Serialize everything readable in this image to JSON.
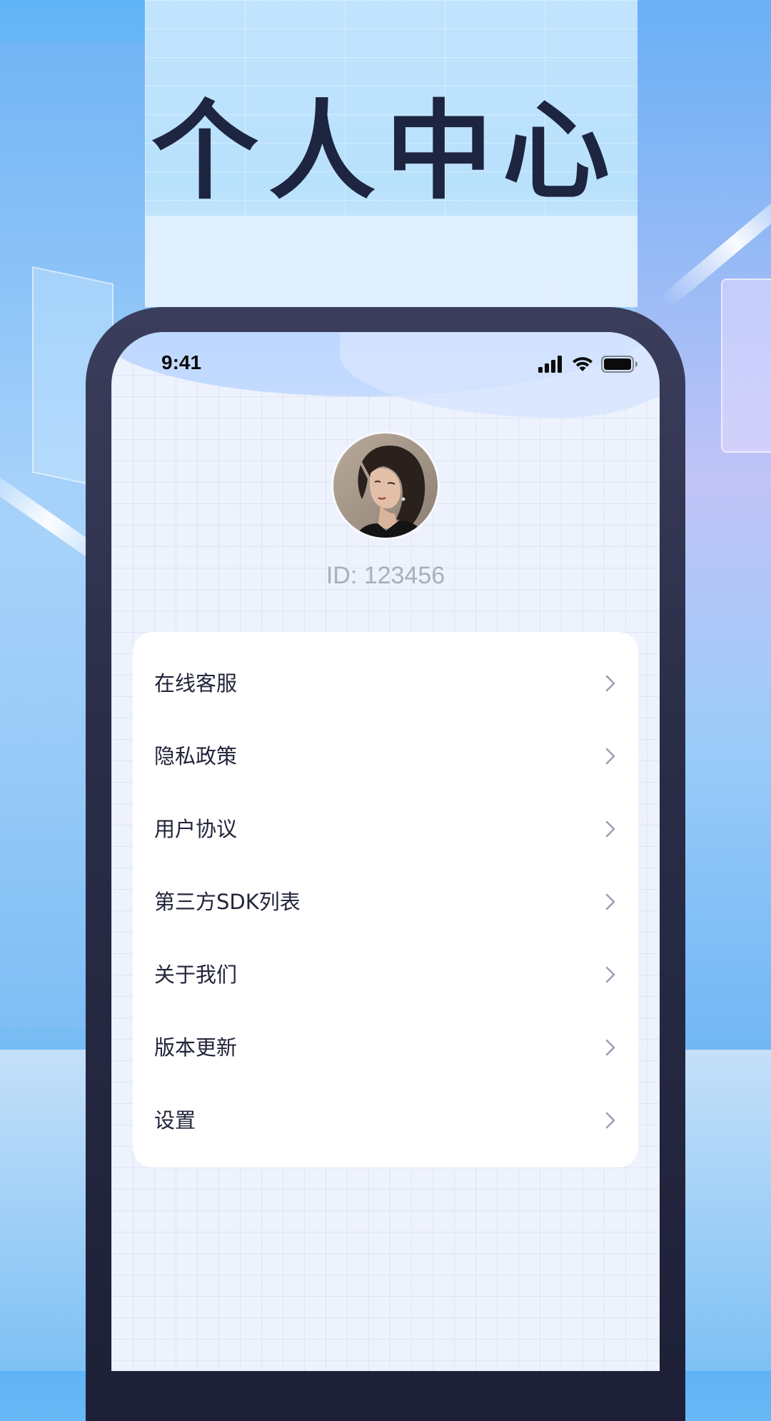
{
  "promo": {
    "headline": "个人中心"
  },
  "status_bar": {
    "time": "9:41",
    "icons": [
      "cellular-signal-icon",
      "wifi-icon",
      "battery-icon"
    ]
  },
  "profile": {
    "avatar_icon": "user-avatar-photo",
    "id_text": "ID: 123456"
  },
  "menu": {
    "items": [
      {
        "label": "在线客服",
        "icon": "chevron-right-icon"
      },
      {
        "label": "隐私政策",
        "icon": "chevron-right-icon"
      },
      {
        "label": "用户协议",
        "icon": "chevron-right-icon"
      },
      {
        "label": "第三方SDK列表",
        "icon": "chevron-right-icon"
      },
      {
        "label": "关于我们",
        "icon": "chevron-right-icon"
      },
      {
        "label": "版本更新",
        "icon": "chevron-right-icon"
      },
      {
        "label": "设置",
        "icon": "chevron-right-icon"
      }
    ]
  },
  "colors": {
    "headline": "#1e2540",
    "phone_frame": "#2a2d47",
    "id_text": "#a9aebb",
    "menu_text": "#22253a",
    "chevron": "#9aa0b4"
  }
}
